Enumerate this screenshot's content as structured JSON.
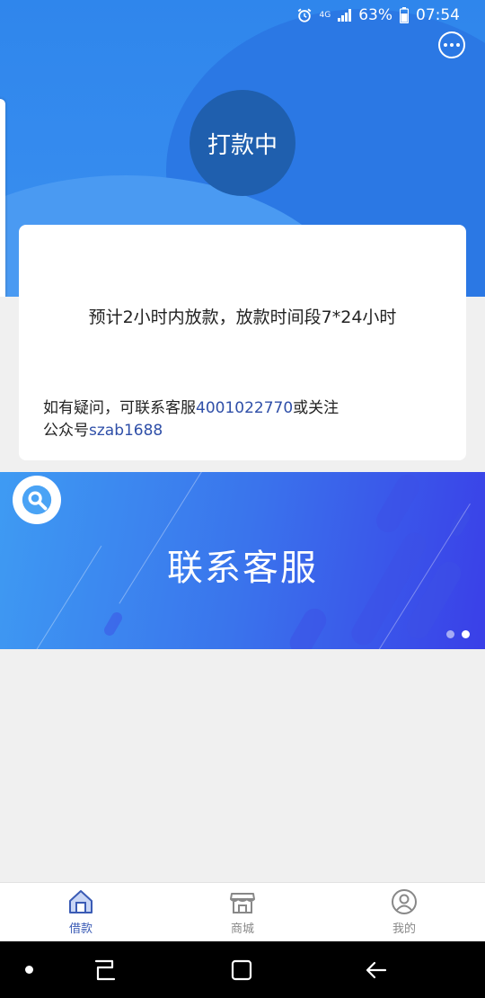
{
  "status_bar": {
    "network": "4G",
    "battery": "63%",
    "time": "07:54"
  },
  "header": {
    "status_label": "打款中"
  },
  "card": {
    "eta_text": "预计2小时内放款，放款时间段7*24小时",
    "help_prefix": "如有疑问，可联系客服",
    "phone": "4001022770",
    "help_middle": "或关注",
    "account_prefix": "公众号",
    "account": "szab1688"
  },
  "banner": {
    "title": "联系客服",
    "active_dot": 1
  },
  "tabbar": {
    "items": [
      {
        "label": "借款",
        "icon": "home-icon",
        "active": true
      },
      {
        "label": "商城",
        "icon": "shop-icon",
        "active": false
      },
      {
        "label": "我的",
        "icon": "profile-icon",
        "active": false
      }
    ]
  },
  "colors": {
    "primary": "#2f86ec",
    "circle": "#1f5fae",
    "link": "#2f4fa8",
    "tab_active": "#3a5bb5",
    "tab_inactive": "#888888"
  }
}
